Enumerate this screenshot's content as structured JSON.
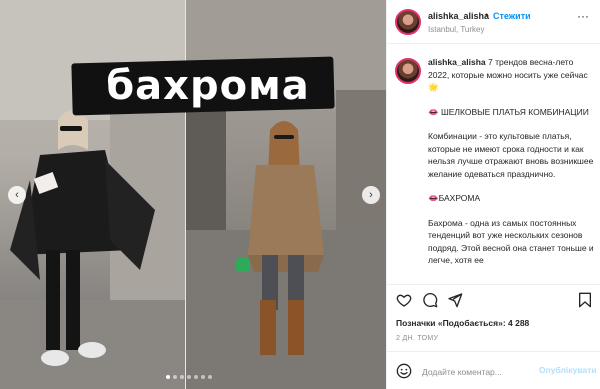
{
  "post": {
    "image_title": "бахрома",
    "carousel_slides": 7,
    "carousel_active": 0
  },
  "header": {
    "username": "alishka_alisha",
    "separator": "•",
    "follow_label": "Стежити",
    "location": "Istanbul, Turkey",
    "more_label": "···"
  },
  "caption": {
    "username": "alishka_alisha",
    "intro": "7 трендов весна-лето 2022, которые можно носить уже сейчас🌟",
    "section1_title": "👄 ШЕЛКОВЫЕ ПЛАТЬЯ КОМБИНАЦИИ",
    "section1_text": "Комбинации - это культовые платья, которые не имеют срока годности и как нельзя лучше отражают вновь возникшее желание одеваться празднично.",
    "section2_title": "👄БАХРОМА",
    "section2_text": "Бахрома - одна из самых постоянных тенденций вот уже нескольких сезонов подряд. Этой весной она станет тоньше и легче, хотя ее"
  },
  "likes_text": "Позначки «Подобається»: 4 288",
  "time_text": "2 ДН. ТОМУ",
  "comment": {
    "placeholder": "Додайте коментар...",
    "publish_label": "Опублікувати"
  },
  "icons": {
    "like": "heart-icon",
    "comment": "comment-icon",
    "share": "send-icon",
    "save": "bookmark-icon",
    "emoji": "smiley-icon"
  },
  "colors": {
    "link_blue": "#0095f6",
    "publish_disabled": "#b2dffc",
    "muted": "#8e8e8e"
  }
}
